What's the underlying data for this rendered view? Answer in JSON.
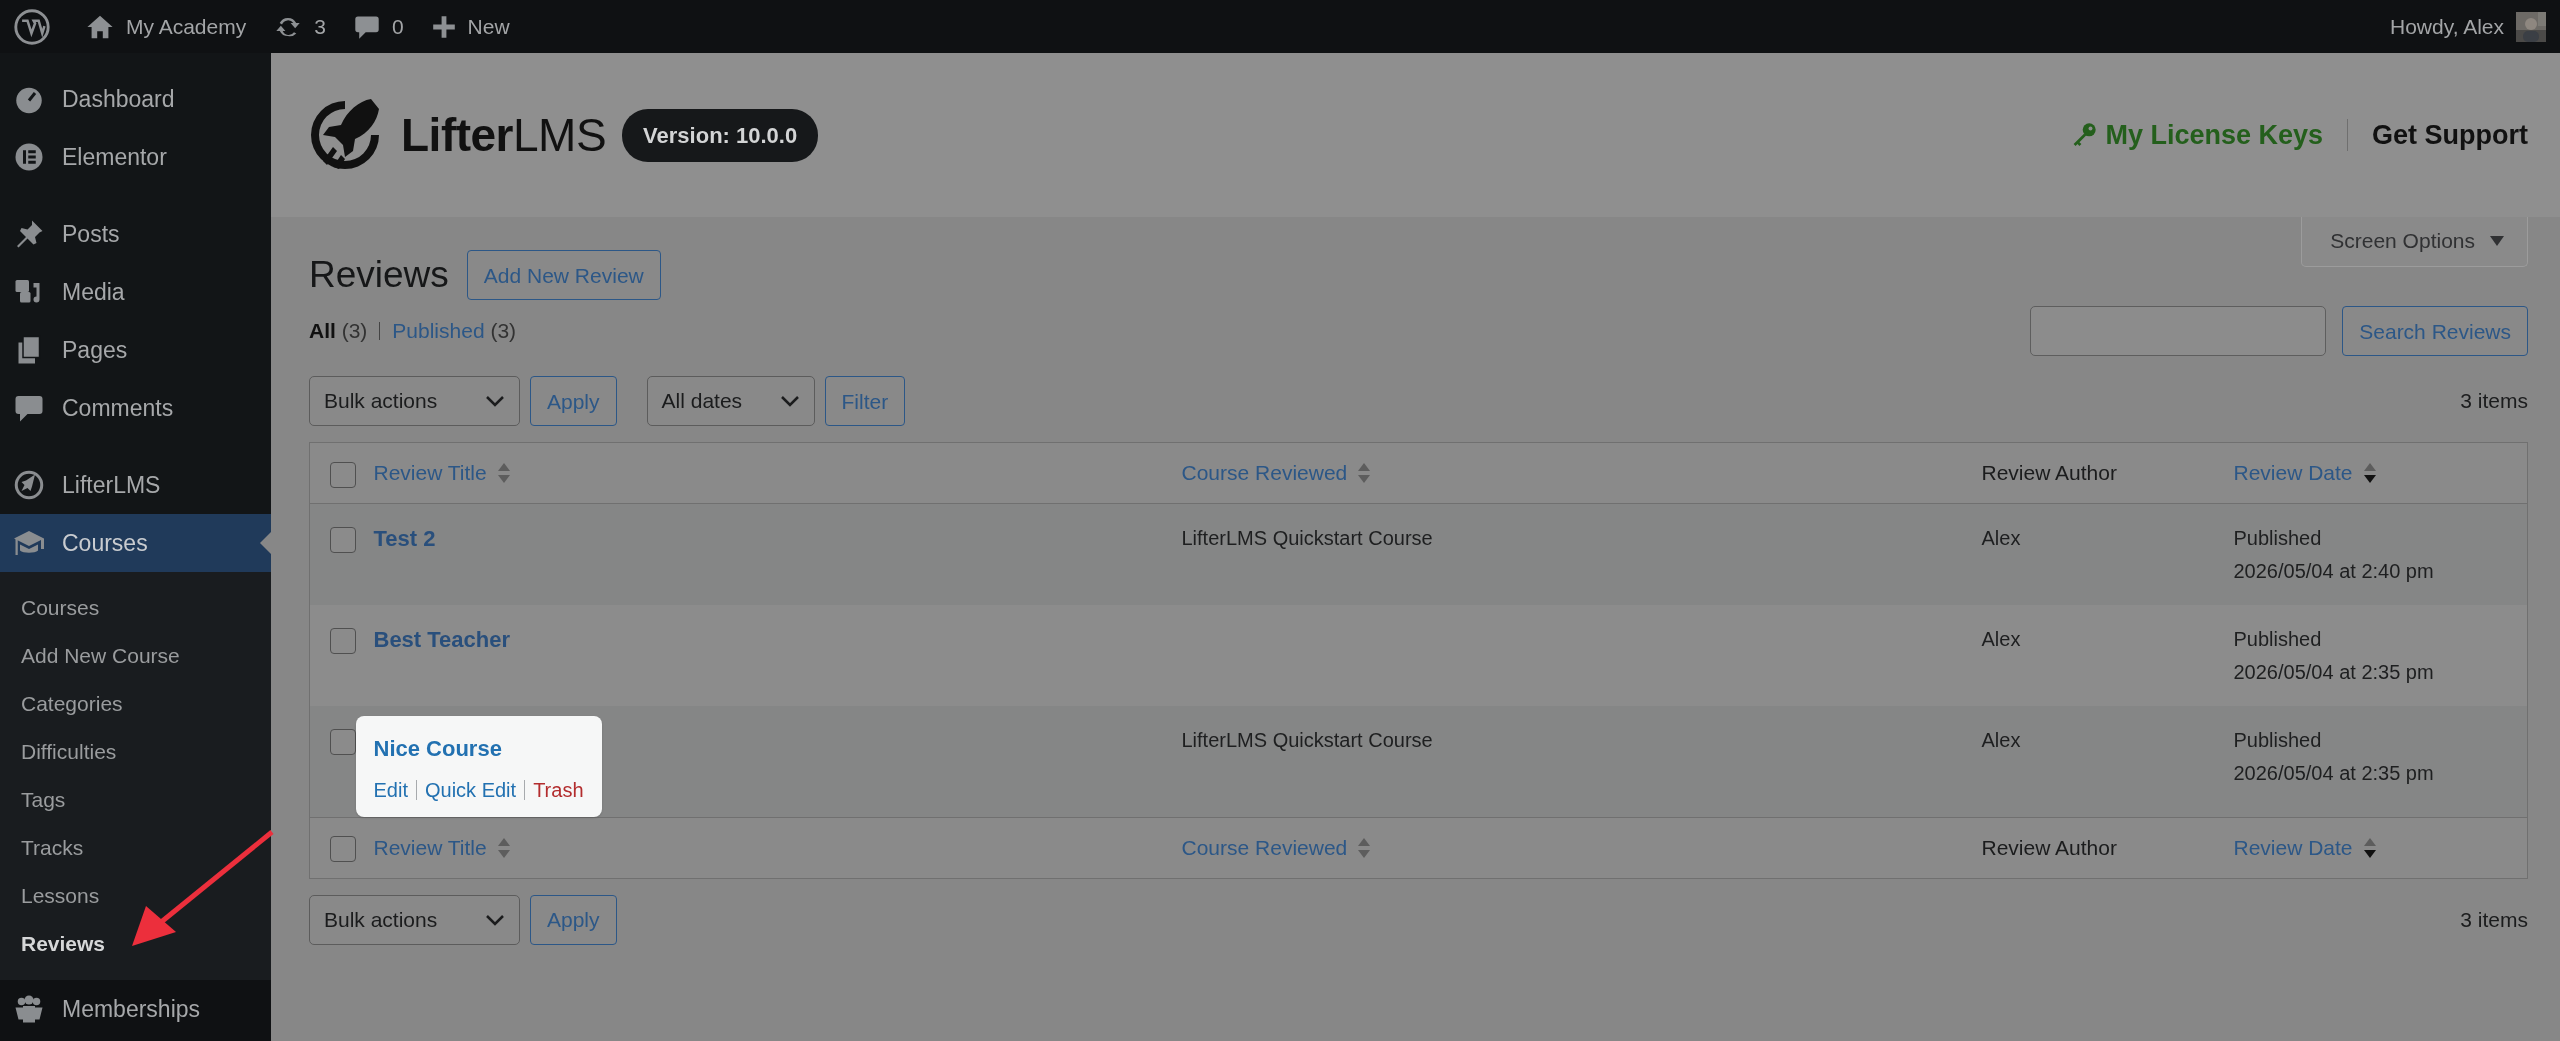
{
  "admin_bar": {
    "site": "My Academy",
    "updates": "3",
    "comments": "0",
    "new": "New",
    "greeting": "Howdy, Alex"
  },
  "sidebar": {
    "groups": [
      [
        {
          "label": "Dashboard",
          "selected": false
        },
        {
          "label": "Elementor",
          "selected": false
        }
      ],
      [
        {
          "label": "Posts",
          "selected": false
        },
        {
          "label": "Media",
          "selected": false
        },
        {
          "label": "Pages",
          "selected": false
        },
        {
          "label": "Comments",
          "selected": false
        }
      ],
      [
        {
          "label": "LifterLMS",
          "selected": false
        },
        {
          "label": "Courses",
          "selected": true,
          "children": [
            {
              "label": "Courses",
              "selected": false
            },
            {
              "label": "Add New Course",
              "selected": false
            },
            {
              "label": "Categories",
              "selected": false
            },
            {
              "label": "Difficulties",
              "selected": false
            },
            {
              "label": "Tags",
              "selected": false
            },
            {
              "label": "Tracks",
              "selected": false
            },
            {
              "label": "Lessons",
              "selected": false
            },
            {
              "label": "Reviews",
              "selected": true
            }
          ]
        },
        {
          "label": "Memberships",
          "selected": false
        }
      ]
    ]
  },
  "header": {
    "brand": "**Lifter**LMS",
    "version": "Version: 10.0.0",
    "license_link": "My License Keys",
    "support_link": "Get Support"
  },
  "screen_options": "Screen Options",
  "page_title": "Reviews",
  "add_button": "Add New Review",
  "views": [
    {
      "label": "All",
      "count": "(3)",
      "selected": true
    },
    {
      "label": "Published",
      "count": "(3)",
      "selected": false
    }
  ],
  "search": {
    "button": "Search Reviews"
  },
  "top_toolbar": {
    "bulk": "Bulk actions",
    "apply": "Apply",
    "dates": "All dates",
    "filter": "Filter",
    "count": "3 items"
  },
  "table": {
    "select_all_checked": false,
    "columns": [
      {
        "label": "Review Title",
        "sortable": true,
        "sorted_desc": false
      },
      {
        "label": "Course Reviewed",
        "sortable": true,
        "sorted_desc": false
      },
      {
        "label": "Review Author",
        "sortable": false,
        "sorted_desc": false
      },
      {
        "label": "Review Date",
        "sortable": true,
        "sorted_desc": true
      }
    ],
    "rows": [
      {
        "checked": false,
        "title": "Test 2",
        "course": "LifterLMS Quickstart Course",
        "author": "Alex",
        "status": "Published",
        "date": "2026/05/04 at 2:40 pm",
        "highlighted": false
      },
      {
        "checked": false,
        "title": "Best Teacher",
        "author": "Alex",
        "status": "Published",
        "date": "2026/05/04 at 2:35 pm",
        "highlighted": false
      },
      {
        "checked": false,
        "title": "Nice Course",
        "course": "LifterLMS Quickstart Course",
        "author": "Alex",
        "status": "Published",
        "date": "2026/05/04 at 2:35 pm",
        "highlighted": true,
        "actions": [
          {
            "label": "Edit",
            "kind": "link"
          },
          {
            "label": "Quick Edit",
            "kind": "link"
          },
          {
            "label": "Trash",
            "kind": "danger"
          }
        ]
      }
    ],
    "footer_select_all_checked": false,
    "footer_columns": [
      {
        "label": "Review Title",
        "sortable": true,
        "sorted_desc": false
      },
      {
        "label": "Course Reviewed",
        "sortable": true,
        "sorted_desc": false
      },
      {
        "label": "Review Author",
        "sortable": false,
        "sorted_desc": false
      },
      {
        "label": "Review Date",
        "sortable": true,
        "sorted_desc": true
      }
    ]
  },
  "bottom_toolbar": {
    "bulk": "Bulk actions",
    "apply": "Apply",
    "count": "3 items"
  }
}
